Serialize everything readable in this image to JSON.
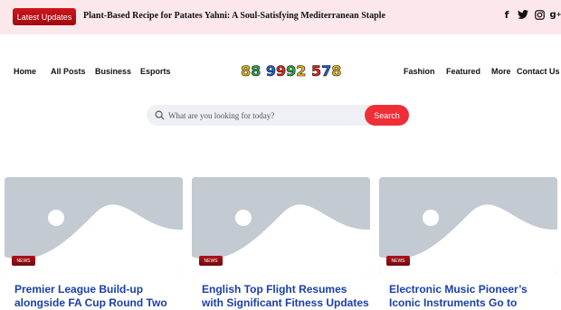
{
  "topbar": {
    "latest_label": "Latest Updates",
    "ticker": "Plant-Based Recipe for Patates Yahni: A Soul-Satisfying Mediterranean Staple",
    "socials": [
      "facebook-icon",
      "twitter-icon",
      "instagram-icon",
      "google-plus-icon"
    ]
  },
  "nav": {
    "left": [
      "Home",
      "All Posts",
      "Business",
      "Esports"
    ],
    "right": [
      "Fashion",
      "Featured",
      "More",
      "Contact Us"
    ]
  },
  "logo": {
    "digits": [
      "8",
      "8",
      " ",
      "9",
      "9",
      "9",
      "2",
      " ",
      "5",
      "7",
      "8"
    ],
    "colors": [
      "#e8b91a",
      "#2fa64a",
      "#ffffff",
      "#1f63d8",
      "#e0281f",
      "#2fa64a",
      "#e8b91a",
      "#ffffff",
      "#e0281f",
      "#1f63d8",
      "#e8b91a"
    ]
  },
  "search": {
    "placeholder": "What are you looking for today?",
    "button_label": "Search"
  },
  "cards": [
    {
      "badge": "NEWS",
      "title": "Premier League Build-up alongside FA Cup Round Two"
    },
    {
      "badge": "NEWS",
      "title": "English Top Flight Resumes with Significant Fitness Updates"
    },
    {
      "badge": "NEWS",
      "title": "Electronic Music Pioneer’s Iconic Instruments Go to American Sale"
    }
  ],
  "colors": {
    "accent": "#f02e36",
    "link": "#1a3faa",
    "topbar_bg": "#fce8ea"
  }
}
